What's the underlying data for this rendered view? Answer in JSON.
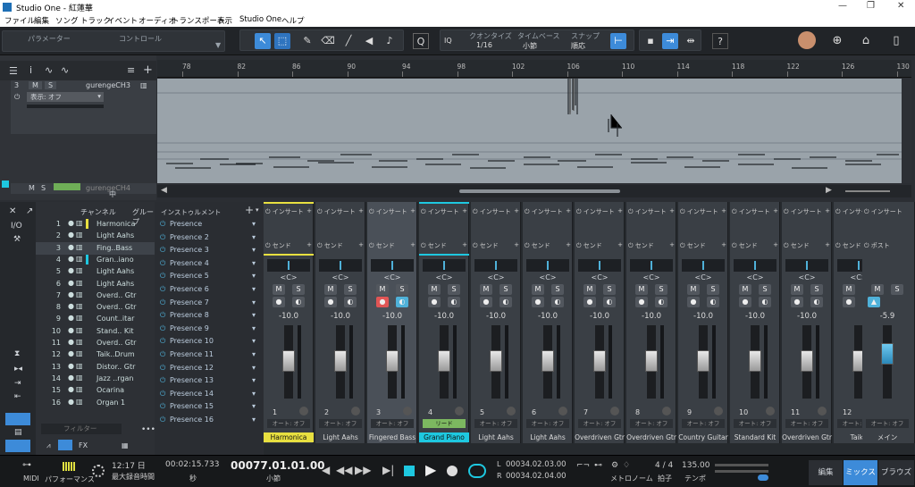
{
  "window": {
    "title": "Studio One - 紅蓮華"
  },
  "menu": [
    "ファイル",
    "編集",
    "ソング",
    "トラック",
    "イベント",
    "オーディオ",
    "トランスポート",
    "表示",
    "Studio One",
    "ヘルプ"
  ],
  "toolbar": {
    "param_label": "パラメーター",
    "control_label": "コントロール",
    "iq": "IQ",
    "quantize_label": "クオンタイズ",
    "quantize_value": "1/16",
    "timebase_label": "タイムベース",
    "timebase_value": "小節",
    "snap_label": "スナップ",
    "snap_value": "順応",
    "help": "?"
  },
  "track": {
    "number": "3",
    "mute": "M",
    "solo": "S",
    "name": "gurengeCH3",
    "display": "表示: オフ",
    "bottom_name": "gurengeCH4",
    "bottom_m": "M",
    "bottom_s": "S",
    "bottom_mid": "中"
  },
  "ruler": [
    "78",
    "82",
    "86",
    "90",
    "94",
    "98",
    "102",
    "106",
    "110",
    "114",
    "118",
    "122",
    "126",
    "130"
  ],
  "mixer_panel": {
    "io": "I/O",
    "channel_header": "チャンネル",
    "group_header": "グループ",
    "instrument_header": "インストゥルメント",
    "filter": "フィルター",
    "fx": "FX"
  },
  "channels": [
    {
      "n": "1",
      "name": "Harmonica"
    },
    {
      "n": "2",
      "name": "Light Aahs"
    },
    {
      "n": "3",
      "name": "Fing..Bass"
    },
    {
      "n": "4",
      "name": "Gran..iano"
    },
    {
      "n": "5",
      "name": "Light Aahs"
    },
    {
      "n": "6",
      "name": "Light Aahs"
    },
    {
      "n": "7",
      "name": "Overd.. Gtr"
    },
    {
      "n": "8",
      "name": "Overd.. Gtr"
    },
    {
      "n": "9",
      "name": "Count..itar"
    },
    {
      "n": "10",
      "name": "Stand.. Kit"
    },
    {
      "n": "11",
      "name": "Overd.. Gtr"
    },
    {
      "n": "12",
      "name": "Taik..Drum"
    },
    {
      "n": "13",
      "name": "Distor.. Gtr"
    },
    {
      "n": "14",
      "name": "Jazz ..rgan"
    },
    {
      "n": "15",
      "name": "Ocarina"
    },
    {
      "n": "16",
      "name": "Organ 1"
    }
  ],
  "instruments": [
    "Presence",
    "Presence 2",
    "Presence 3",
    "Presence 4",
    "Presence 5",
    "Presence 6",
    "Presence 7",
    "Presence 8",
    "Presence 9",
    "Presence 10",
    "Presence 11",
    "Presence 12",
    "Presence 13",
    "Presence 14",
    "Presence 15",
    "Presence 16"
  ],
  "strip_labels": {
    "insert": "インサート",
    "send": "センド",
    "pan": "<C>",
    "mute": "M",
    "solo": "S",
    "auto": "オート: オフ",
    "read": "リード",
    "post": "ポスト"
  },
  "strips": [
    {
      "n": "1",
      "name": "Harmonica",
      "vol": "-10.0",
      "color": "#e8e040"
    },
    {
      "n": "2",
      "name": "Light Aahs",
      "vol": "-10.0",
      "color": ""
    },
    {
      "n": "3",
      "name": "Fingered Bass",
      "vol": "-10.0",
      "color": ""
    },
    {
      "n": "4",
      "name": "Grand Piano",
      "vol": "-10.0",
      "color": "#1ec8e0"
    },
    {
      "n": "5",
      "name": "Light Aahs",
      "vol": "-10.0",
      "color": ""
    },
    {
      "n": "6",
      "name": "Light Aahs",
      "vol": "-10.0",
      "color": ""
    },
    {
      "n": "7",
      "name": "Overdriven Gtr",
      "vol": "-10.0",
      "color": ""
    },
    {
      "n": "8",
      "name": "Overdriven Gtr",
      "vol": "-10.0",
      "color": ""
    },
    {
      "n": "9",
      "name": "Country Guitar",
      "vol": "-10.0",
      "color": ""
    },
    {
      "n": "10",
      "name": "Standard Kit",
      "vol": "-10.0",
      "color": ""
    },
    {
      "n": "11",
      "name": "Overdriven Gtr",
      "vol": "-10.0",
      "color": ""
    },
    {
      "n": "12",
      "name": "Taiko",
      "vol": "",
      "color": ""
    }
  ],
  "main_strip": {
    "name": "メイン",
    "vol": "-5.9"
  },
  "transport": {
    "midi": "MIDI",
    "perf": "パフォーマンス",
    "time": "12:17 日",
    "max_rec": "最大録音時間",
    "seconds": "00:02:15.733",
    "sec_unit": "秒",
    "position": "00077.01.01.00",
    "pos_unit": "小節",
    "L": "L",
    "R": "R",
    "loop_l": "00034.02.03.00",
    "loop_r": "00034.02.04.00",
    "metronome": "メトロノーム",
    "timesig": "4 / 4",
    "timesig_label": "拍子",
    "tempo": "135.00",
    "tempo_label": "テンポ",
    "edit": "編集",
    "mix": "ミックス",
    "browse": "ブラウズ"
  }
}
